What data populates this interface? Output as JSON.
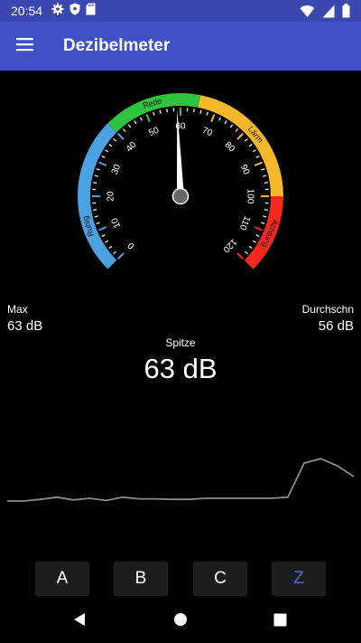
{
  "status_bar": {
    "time": "20:54",
    "left_icons": [
      "gear-icon",
      "shield-icon",
      "sd-card-icon"
    ],
    "right_icons": [
      "wifi-icon",
      "cell-signal-icon",
      "battery-icon"
    ]
  },
  "app_bar": {
    "title": "Dezibelmeter",
    "menu_icon": "hamburger-menu-icon"
  },
  "gauge": {
    "scale_labels": [
      "0",
      "10",
      "20",
      "30",
      "40",
      "50",
      "60",
      "70",
      "80",
      "90",
      "100",
      "110",
      "120"
    ],
    "zones": [
      {
        "label": "Ruhig",
        "color": "#4aa3e0",
        "from": 0,
        "to": 40
      },
      {
        "label": "Rede",
        "color": "#2ec440",
        "from": 40,
        "to": 65
      },
      {
        "label": "Lärm",
        "color": "#f5b82a",
        "from": 65,
        "to": 100
      },
      {
        "label": "Achtung",
        "color": "#f2291c",
        "from": 100,
        "to": 120
      }
    ],
    "needle_value": 59
  },
  "stats": {
    "max_label": "Max",
    "max_value": "63 dB",
    "avg_label": "Durchschn",
    "avg_value": "56 dB",
    "peak_label": "Spitze",
    "peak_value": "63 dB"
  },
  "history": {
    "values": [
      56,
      56,
      56.3,
      56.7,
      56.2,
      56.5,
      56.1,
      56.7,
      56.4,
      56.4,
      56.3,
      56.3,
      56.5,
      56.5,
      56.5,
      56.5,
      56.5,
      56.7,
      63,
      63.8,
      62.5,
      60.5
    ]
  },
  "weighting_buttons": {
    "a": "A",
    "b": "B",
    "c": "C",
    "z": "Z",
    "selected": "Z",
    "selected_color": "#5b66d6"
  },
  "nav_bar": {
    "icons": [
      "back-icon",
      "home-icon",
      "recents-icon"
    ]
  }
}
